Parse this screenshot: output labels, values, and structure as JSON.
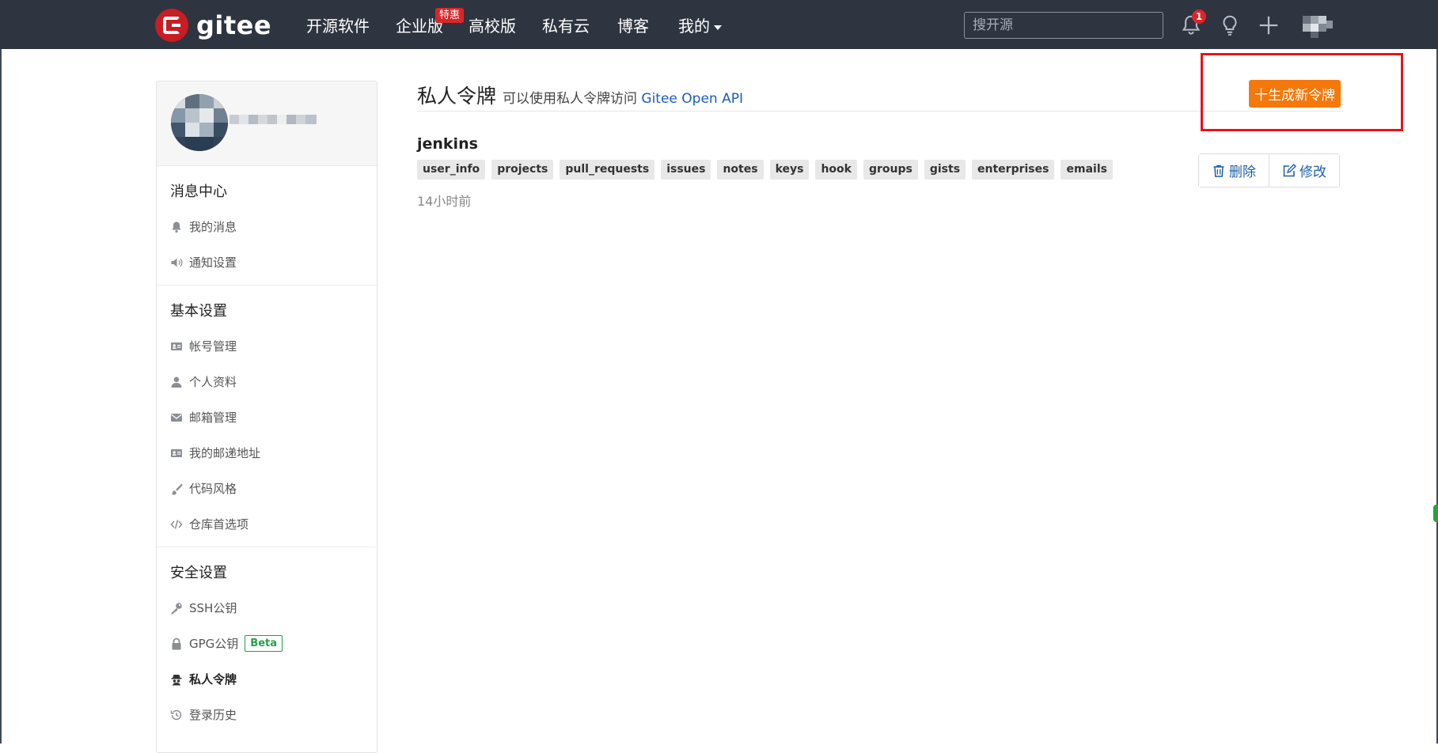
{
  "topbar": {
    "logo_text": "gitee",
    "nav": [
      "开源软件",
      "企业版",
      "高校版",
      "私有云",
      "博客",
      "我的"
    ],
    "special_badge": "特惠",
    "search_placeholder": "搜开源",
    "notification_count": "1"
  },
  "sidebar": {
    "sections": [
      {
        "title": "消息中心",
        "items": [
          {
            "label": "我的消息",
            "icon": "bell-icon"
          },
          {
            "label": "通知设置",
            "icon": "volume-icon"
          }
        ]
      },
      {
        "title": "基本设置",
        "items": [
          {
            "label": "帐号管理",
            "icon": "id-card-icon"
          },
          {
            "label": "个人资料",
            "icon": "user-icon"
          },
          {
            "label": "邮箱管理",
            "icon": "envelope-icon"
          },
          {
            "label": "我的邮递地址",
            "icon": "address-card-icon"
          },
          {
            "label": "代码风格",
            "icon": "brush-icon"
          },
          {
            "label": "仓库首选项",
            "icon": "code-icon"
          }
        ]
      },
      {
        "title": "安全设置",
        "items": [
          {
            "label": "SSH公钥",
            "icon": "key-icon"
          },
          {
            "label": "GPG公钥",
            "icon": "lock-icon",
            "badge": "Beta"
          },
          {
            "label": "私人令牌",
            "icon": "spy-icon",
            "active": true
          },
          {
            "label": "登录历史",
            "icon": "history-icon"
          }
        ]
      }
    ]
  },
  "main": {
    "title": "私人令牌",
    "subtitle_text": "可以使用私人令牌访问",
    "subtitle_link": "Gitee Open API",
    "generate_button": "十生成新令牌",
    "token": {
      "name": "jenkins",
      "scopes": [
        "user_info",
        "projects",
        "pull_requests",
        "issues",
        "notes",
        "keys",
        "hook",
        "groups",
        "gists",
        "enterprises",
        "emails"
      ],
      "time": "14小时前",
      "delete_label": "删除",
      "edit_label": "修改"
    }
  },
  "colors": {
    "topbar_bg": "#2e3440",
    "accent_orange": "#f5780a",
    "brand_red": "#c71d23",
    "link_blue": "#1a5cb8",
    "highlight_box": "#e8131a"
  }
}
